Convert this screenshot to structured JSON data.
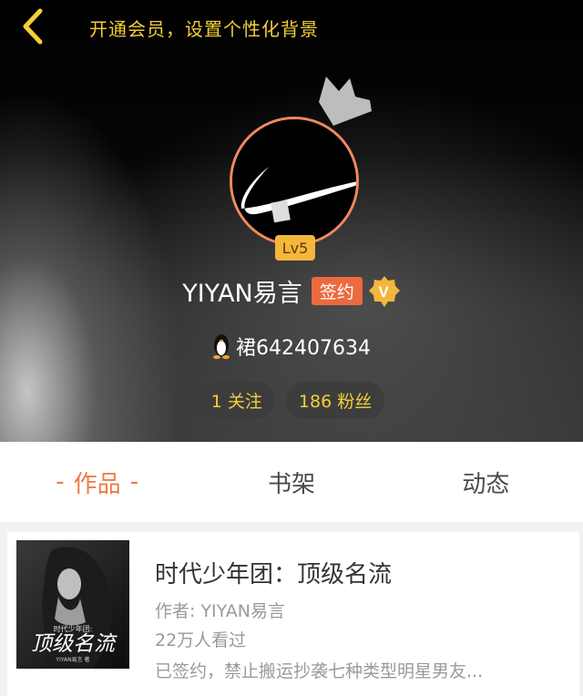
{
  "header": {
    "vip_link": "开通会员，设置个性化背景",
    "level": "Lv5",
    "username": "YIYAN易言",
    "sign_badge": "签约",
    "qq_text": "裙642407634",
    "stats": [
      {
        "label": "1 关注"
      },
      {
        "label": "186 粉丝"
      }
    ]
  },
  "tabs": [
    {
      "dash_left": "-",
      "label": "作品",
      "dash_right": "-",
      "active": true
    },
    {
      "label": "书架",
      "active": false
    },
    {
      "label": "动态",
      "active": false
    }
  ],
  "works": [
    {
      "title": "时代少年团：顶级名流",
      "author": "作者: YIYAN易言",
      "views": "22万人看过",
      "description": "已签约，禁止搬运抄袭七种类型明星男友...",
      "cover_text": "顶级名流",
      "cover_sub": "时代少年团:",
      "cover_small": "YIYAN易言 著"
    }
  ],
  "colors": {
    "accent_gold": "#f3cf3a",
    "accent_orange": "#ef7a45",
    "avatar_ring": "#f0895f",
    "level_badge": "#f4b63c",
    "sign_badge": "#ec6a3f"
  }
}
